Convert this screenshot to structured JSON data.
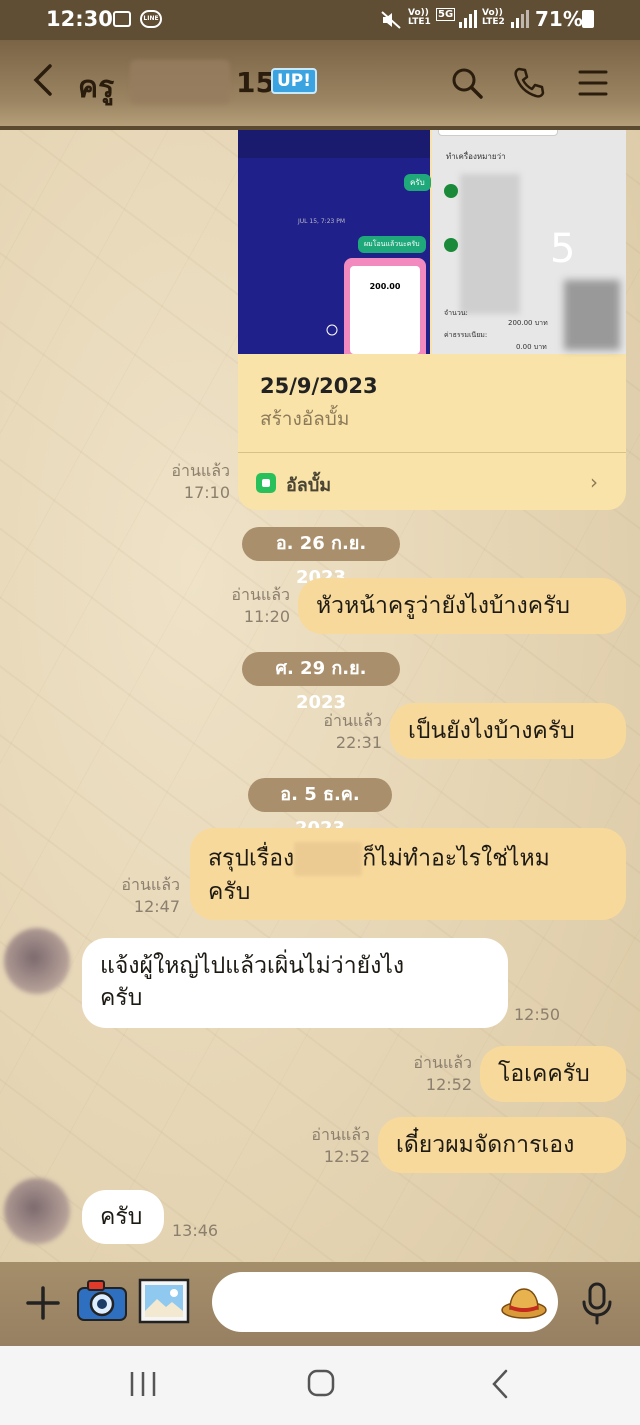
{
  "status_bar": {
    "time": "12:30",
    "line_label": "LINE",
    "lte1": "LTE1",
    "lte2": "LTE2",
    "volte": "Vo))",
    "net": "5G",
    "battery": "71%"
  },
  "header": {
    "title": "ครู",
    "name_suffix": "15",
    "up_badge": "UP!"
  },
  "album": {
    "date": "25/9/2023",
    "subtitle": "สร้างอัลบั้ม",
    "label": "อัลบั้ม",
    "read_label": "อ่านแล้ว",
    "time": "17:10",
    "thumb_left": {
      "reply_a": "ครับ",
      "sent_time": "JUL 15, 7:23 PM",
      "reply_b": "ผมโอนแล้วนะครับ",
      "amount": "200.00"
    },
    "thumb_right": {
      "heading": "ทำเครื่องหมายว่า",
      "row1_label": "จำนวน:",
      "row1_value": "200.00 บาท",
      "row2_label": "ค่าธรรมเนียม:",
      "row2_value": "0.00 บาท",
      "digit": "5"
    }
  },
  "chips": [
    "อ. 26 ก.ย. 2023",
    "ศ. 29 ก.ย. 2023",
    "อ. 5 ธ.ค. 2023"
  ],
  "messages": [
    {
      "from": "me",
      "text": "หัวหน้าครูว่ายังไงบ้างครับ",
      "read": "อ่านแล้ว",
      "time": "11:20"
    },
    {
      "from": "me",
      "text": "เป็นยังไงบ้างครับ",
      "read": "อ่านแล้ว",
      "time": "22:31"
    },
    {
      "from": "me",
      "text_a": "สรุปเรื่อง",
      "text_b": "ก็ไม่ทำอะไรใช่ไหม",
      "text_c": "ครับ",
      "read": "อ่านแล้ว",
      "time": "12:47"
    },
    {
      "from": "them",
      "text_a": "แจ้งผู้ใหญ่ไปแล้วเผิ่นไม่ว่ายังไง",
      "text_b": "ครับ",
      "time": "12:50"
    },
    {
      "from": "me",
      "text": "โอเคครับ",
      "read": "อ่านแล้ว",
      "time": "12:52"
    },
    {
      "from": "me",
      "text": "เดี๋ยวผมจัดการเอง",
      "read": "อ่านแล้ว",
      "time": "12:52"
    },
    {
      "from": "them",
      "text": "ครับ",
      "time": "13:46"
    }
  ],
  "colors": {
    "bubble_me": "#f8d99c",
    "bubble_them": "#ffffff",
    "chip": "#a98f6c",
    "header": "#8c7553"
  }
}
